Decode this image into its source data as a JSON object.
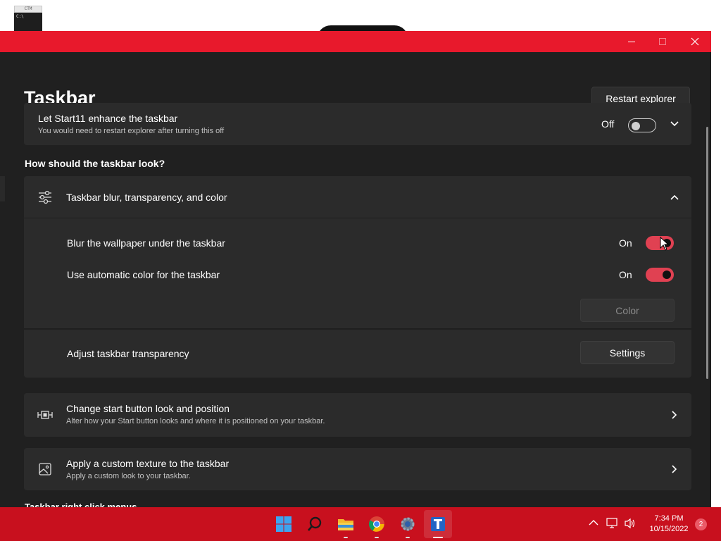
{
  "desktop": {
    "shortcut_label": "CTM",
    "shortcut_prompt": "C:\\"
  },
  "window": {
    "controls": {
      "minimize": "—",
      "maximize": "□",
      "close": "✕"
    }
  },
  "header": {
    "title": "Taskbar",
    "restart_button": "Restart explorer"
  },
  "enhance": {
    "title": "Let Start11 enhance the taskbar",
    "subtitle": "You would need to restart explorer after turning this off",
    "state_label": "Off",
    "enabled": false
  },
  "section_look": {
    "heading": "How should the taskbar look?",
    "blur_card": {
      "title": "Taskbar blur, transparency, and color",
      "options": [
        {
          "label": "Blur the wallpaper under the taskbar",
          "state_label": "On",
          "enabled": true
        },
        {
          "label": "Use automatic color for the taskbar",
          "state_label": "On",
          "enabled": true
        }
      ],
      "color_button": "Color",
      "transparency_label": "Adjust taskbar transparency",
      "settings_button": "Settings"
    },
    "start_button_card": {
      "title": "Change start button look and position",
      "subtitle": "Alter how your Start button looks and where it is positioned on your taskbar."
    },
    "texture_card": {
      "title": "Apply a custom texture to the taskbar",
      "subtitle": "Apply a custom look to your taskbar."
    }
  },
  "cutoff_heading": "Taskbar right click menus",
  "taskbar": {
    "apps": [
      "start-icon",
      "search-icon",
      "file-explorer-icon",
      "chrome-icon",
      "settings-icon",
      "start11-icon"
    ],
    "time": "7:34 PM",
    "date": "10/15/2022",
    "notification_count": "2"
  },
  "colors": {
    "accent": "#e8192c",
    "taskbar": "#c8101e",
    "toggle_on": "#e04152",
    "background": "#202020",
    "card": "#2b2b2b"
  }
}
